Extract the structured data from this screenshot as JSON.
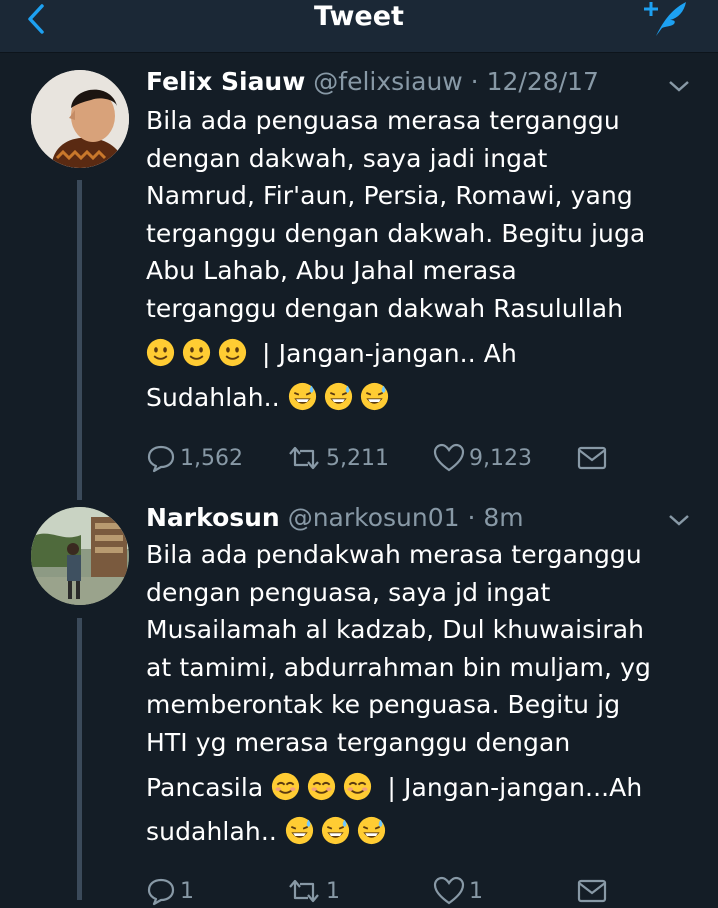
{
  "header": {
    "title": "Tweet"
  },
  "tweets": [
    {
      "name": "Felix Siauw",
      "handle": "@felixsiauw",
      "time": "12/28/17",
      "text_lines": [
        "Bila ada penguasa merasa terganggu",
        "dengan dakwah, saya jadi ingat",
        "Namrud, Fir'aun, Persia, Romawi, yang",
        "terganggu dengan dakwah. Begitu juga",
        "Abu Lahab, Abu Jahal merasa",
        "terganggu dengan dakwah Rasulullah"
      ],
      "line7_text": " | Jangan-jangan.. Ah",
      "line8_text": "Sudahlah.. ",
      "replies": "1,562",
      "retweets": "5,211",
      "likes": "9,123"
    },
    {
      "name": "Narkosun",
      "handle": "@narkosun01",
      "time": "8m",
      "text_lines": [
        "Bila ada pendakwah merasa terganggu",
        "dengan penguasa, saya jd ingat",
        "Musailamah al kadzab, Dul khuwaisirah",
        "at tamimi, abdurrahman bin muljam, yg",
        "memberontak ke penguasa. Begitu jg",
        "HTI yg merasa terganggu dengan"
      ],
      "line7_text": "Pancasila ",
      "line7_tail": " | Jangan-jangan...Ah",
      "line8_text": "sudahlah.. ",
      "replies": "1",
      "retweets": "1",
      "likes": "1"
    }
  ],
  "emoji": {
    "smile": "slightly-smiling-face",
    "sweat": "grinning-face-with-sweat",
    "blush": "smiling-face-with-smiling-eyes"
  },
  "colors": {
    "background": "#141d26",
    "bar": "#1b2836",
    "accent": "#1da1f2",
    "muted": "#8899a6"
  }
}
